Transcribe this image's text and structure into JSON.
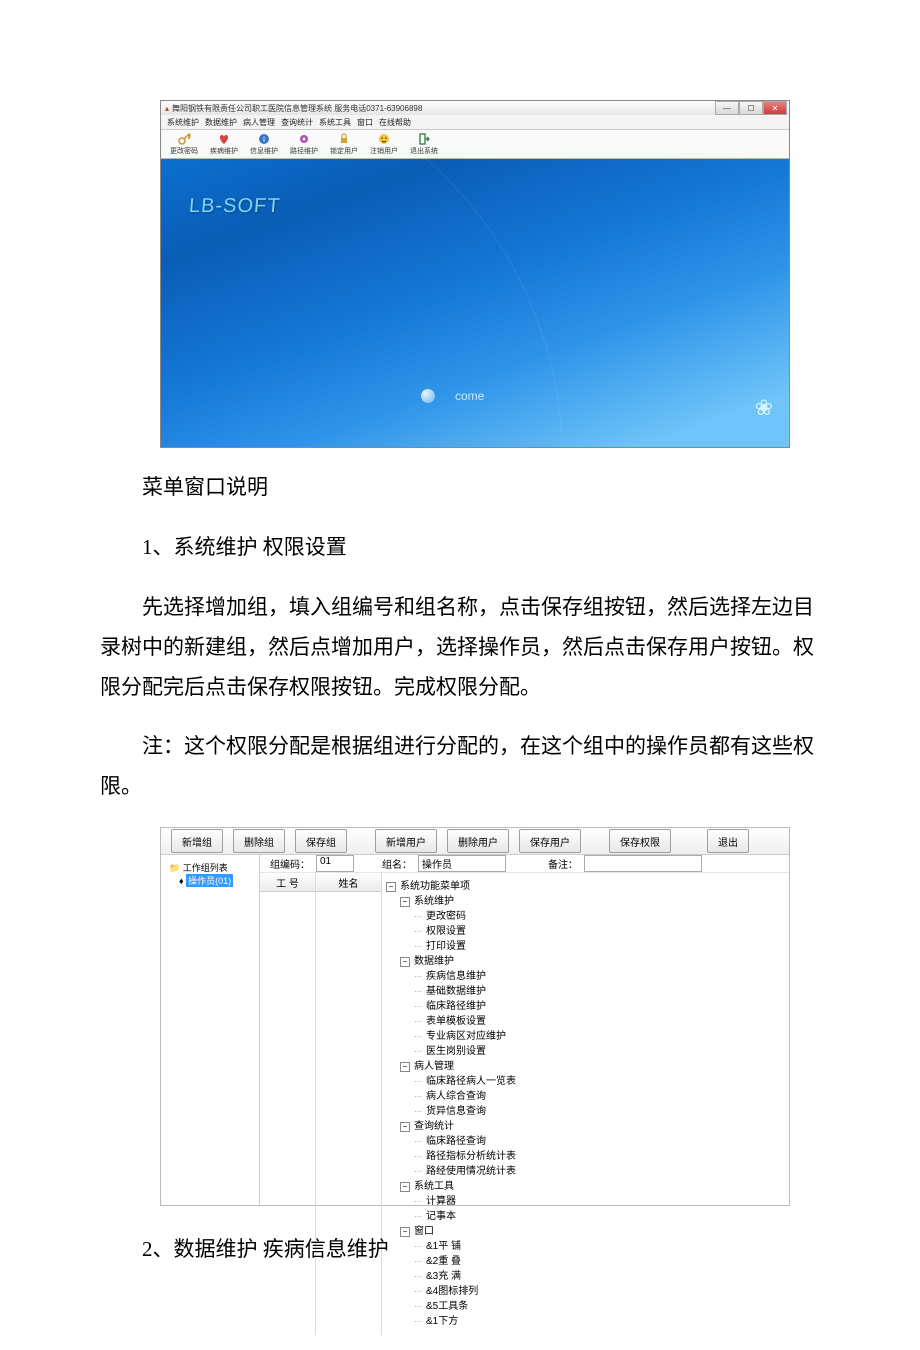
{
  "screenshot1": {
    "title": "舞阳钢铁有限责任公司职工医院信息管理系统 服务电话0371-63906898",
    "menus": [
      "系统维护",
      "数据维护",
      "病人管理",
      "查询统计",
      "系统工具",
      "窗口",
      "在线帮助"
    ],
    "toolbar": [
      {
        "label": "更改密码"
      },
      {
        "label": "疾病维护"
      },
      {
        "label": "信息维护"
      },
      {
        "label": "路径维护"
      },
      {
        "label": "锁定用户"
      },
      {
        "label": "注销用户"
      },
      {
        "label": "退出系统"
      }
    ],
    "logo": "LB-SOFT",
    "come": "come"
  },
  "para1": "菜单窗口说明",
  "para2": "1、系统维护   权限设置",
  "para3": "先选择增加组，填入组编号和组名称，点击保存组按钮，然后选择左边目录树中的新建组，然后点增加用户，选择操作员，然后点击保存用户按钮。权限分配完后点击保存权限按钮。完成权限分配。",
  "para4": "注：这个权限分配是根据组进行分配的，在这个组中的操作员都有这些权限。",
  "screenshot2": {
    "buttons_group1": [
      "新增组",
      "删除组",
      "保存组"
    ],
    "buttons_group2": [
      "新增用户",
      "删除用户",
      "保存用户"
    ],
    "buttons_group3": [
      "保存权限"
    ],
    "buttons_group4": [
      "退出"
    ],
    "left_tree_root": "工作组列表",
    "left_tree_item": "操作员(01)",
    "form": {
      "label_code": "组编码：",
      "value_code": "01",
      "label_name": "组名：",
      "value_name": "操作员",
      "label_remark": "备注："
    },
    "col_headers": [
      "工 号",
      "姓名"
    ],
    "perm_tree": [
      {
        "lvl": 0,
        "type": "node minus",
        "text": "系统功能菜单项"
      },
      {
        "lvl": 1,
        "type": "node minus",
        "text": "系统维护"
      },
      {
        "lvl": 2,
        "type": "leaf",
        "text": "更改密码"
      },
      {
        "lvl": 2,
        "type": "leaf",
        "text": "权限设置"
      },
      {
        "lvl": 2,
        "type": "leaf",
        "text": "打印设置"
      },
      {
        "lvl": 1,
        "type": "node minus",
        "text": "数据维护"
      },
      {
        "lvl": 2,
        "type": "leaf",
        "text": "疾病信息维护"
      },
      {
        "lvl": 2,
        "type": "leaf",
        "text": "基础数据维护"
      },
      {
        "lvl": 2,
        "type": "leaf",
        "text": "临床路径维护"
      },
      {
        "lvl": 2,
        "type": "leaf",
        "text": "表单模板设置"
      },
      {
        "lvl": 2,
        "type": "leaf",
        "text": "专业病区对应维护"
      },
      {
        "lvl": 2,
        "type": "leaf",
        "text": "医生岗别设置"
      },
      {
        "lvl": 1,
        "type": "node minus",
        "text": "病人管理"
      },
      {
        "lvl": 2,
        "type": "leaf",
        "text": "临床路径病人一览表"
      },
      {
        "lvl": 2,
        "type": "leaf",
        "text": "病人综合查询"
      },
      {
        "lvl": 2,
        "type": "leaf",
        "text": "货异信息查询"
      },
      {
        "lvl": 1,
        "type": "node minus",
        "text": "查询统计"
      },
      {
        "lvl": 2,
        "type": "leaf",
        "text": "临床路径查询"
      },
      {
        "lvl": 2,
        "type": "leaf",
        "text": "路径指标分析统计表"
      },
      {
        "lvl": 2,
        "type": "leaf",
        "text": "路经使用情况统计表"
      },
      {
        "lvl": 1,
        "type": "node minus",
        "text": "系统工具"
      },
      {
        "lvl": 2,
        "type": "leaf",
        "text": "计算器"
      },
      {
        "lvl": 2,
        "type": "leaf",
        "text": "记事本"
      },
      {
        "lvl": 1,
        "type": "node minus",
        "text": "窗口"
      },
      {
        "lvl": 2,
        "type": "leaf",
        "text": "&1平 铺"
      },
      {
        "lvl": 2,
        "type": "leaf",
        "text": "&2重 叠"
      },
      {
        "lvl": 2,
        "type": "leaf",
        "text": "&3充 满"
      },
      {
        "lvl": 2,
        "type": "leaf",
        "text": "&4图标排列"
      },
      {
        "lvl": 2,
        "type": "leaf",
        "text": "&5工具条"
      },
      {
        "lvl": 2,
        "type": "leaf",
        "text": "&1下方"
      }
    ]
  },
  "para5": "2、数据维护  疾病信息维护"
}
